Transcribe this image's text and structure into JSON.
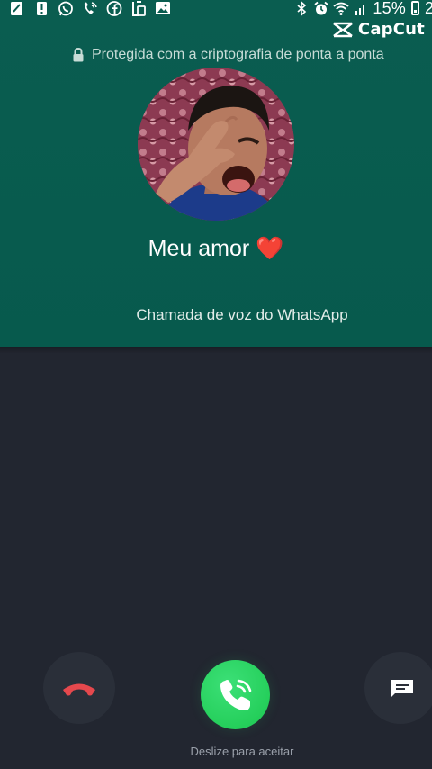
{
  "status_bar": {
    "left_icons": [
      "note-icon",
      "alert-icon",
      "whatsapp-icon",
      "phone-call-icon",
      "facebook-icon",
      "media-icon",
      "image-icon"
    ],
    "right_icons": [
      "bluetooth-icon",
      "alarm-icon",
      "wifi-icon",
      "signal-icon"
    ],
    "battery": "15%",
    "clock_partial": "2"
  },
  "watermark": {
    "label": "CapCut"
  },
  "call": {
    "encryption_notice": "Protegida com a criptografia de ponta a ponta",
    "contact_name": "Meu amor",
    "contact_emoji": "❤️",
    "call_type": "Chamada de voz do WhatsApp",
    "swipe_hint": "Deslize para aceitar"
  },
  "colors": {
    "header_bg": "#075a4d",
    "body_bg": "#222630",
    "accept": "#25d366",
    "decline_icon": "#e5484d"
  }
}
